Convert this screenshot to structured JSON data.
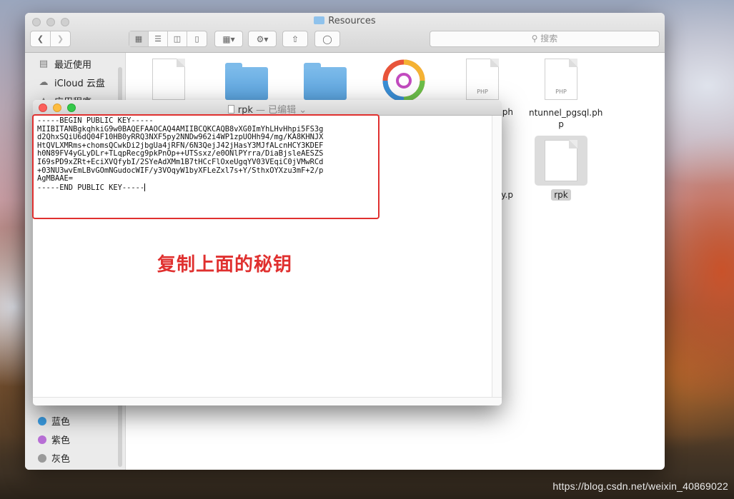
{
  "finder": {
    "title": "Resources",
    "search_placeholder": "搜索",
    "sidebar_items": [
      {
        "label": "最近使用",
        "icon": "recents-icon"
      },
      {
        "label": "iCloud 云盘",
        "icon": "cloud-icon"
      },
      {
        "label": "应用程序",
        "icon": "apps-icon"
      }
    ],
    "tags": [
      {
        "label": "蓝色",
        "color": "#3a9be0"
      },
      {
        "label": "紫色",
        "color": "#b86fd6"
      },
      {
        "label": "灰色",
        "color": "#9a9a9a"
      }
    ],
    "files": [
      {
        "label": "gl.ph"
      },
      {
        "label": "ntunnel_pgsql.ph p"
      },
      {
        "label": "ey.p"
      },
      {
        "label": "rpk"
      }
    ],
    "php_badge": "PHP"
  },
  "editor": {
    "title": "rpk",
    "status": " — 已编辑",
    "key_lines": [
      "-----BEGIN PUBLIC KEY-----",
      "MIIBITANBgkqhkiG9w0BAQEFAAOCAQ4AMIIBCQKCAQB8vXG0ImYhLHvHhpi5FS3g",
      "d2QhxSQiU6dQ04F10HB0yRRQ3NXF5py2NNDw962i4WP1zpUOHh94/mg/KA8KHNJX",
      "HtQVLXMRms+chomsQCwkDi2jbgUa4jRFN/6N3QejJ42jHasY3MJfALcnHCY3KDEF",
      "h0N89FV4yGLyDLr+TLqpRecg9pkPnOp++UTSsxz/e0ONlPYrra/DiaBjsleAESZS",
      "I69sPD9xZRt+EciXVQfybI/2SYeAdXMm1B7tHCcFlOxeUgqYV03VEqiC0jVMwRCd",
      "+03NU3wvEmLBvGOmNGudocWIF/y3VOqyW1byXFLeZxl7s+Y/SthxOYXzu3mF+2/p",
      "AgMBAAE=",
      "-----END PUBLIC KEY-----"
    ]
  },
  "annotation": "复制上面的秘钥",
  "watermark": "https://blog.csdn.net/weixin_40869022"
}
